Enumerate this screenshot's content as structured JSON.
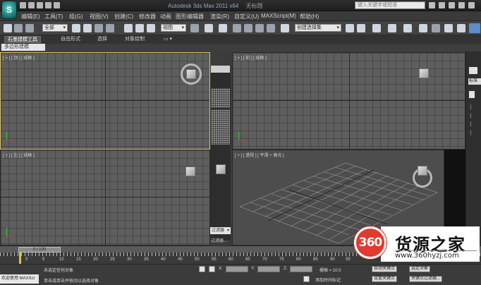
{
  "titlebar": {
    "logo_glyph": "S",
    "app_title": "Autodesk 3ds Max 2011 x64",
    "doc_title": "无标题",
    "search_placeholder": "键入关键字或短语"
  },
  "menu": [
    "编辑(E)",
    "工具(T)",
    "组(G)",
    "视图(V)",
    "创建(C)",
    "修改器",
    "动画",
    "图形编辑器",
    "渲染(R)",
    "自定义(U)",
    "MAXScript(M)",
    "帮助(H)"
  ],
  "toolbar": {
    "selection_filter": "全部",
    "ref_coord": "视图",
    "named_selection": "创建选择集"
  },
  "ribbon": {
    "tabs": [
      "石墨建模工具",
      "自由形式",
      "选择",
      "对象绘制"
    ],
    "active_tab": 0,
    "panel_label": "多边形建模"
  },
  "viewports": {
    "top": "[ + ] [ 顶 ] [ 线框 ]",
    "front": "[ + ] [ 前 ] [ 线框 ]",
    "left": "[ + ] [ 左 ] [ 线框 ]",
    "persp": "[ + ] [ 透视 ] [ 平滑 + 高光 ]"
  },
  "side": {
    "dropdown": "过滤器",
    "label": "过滤器..."
  },
  "cmdpanel": {
    "label": "标准"
  },
  "timeline": {
    "frame": "0 / 100",
    "ruler_numbers": [
      "0",
      "5",
      "10",
      "15",
      "20",
      "25",
      "30",
      "35",
      "40",
      "45",
      "50",
      "55",
      "60",
      "65",
      "70",
      "75",
      "80",
      "85",
      "90",
      "95",
      "100"
    ]
  },
  "status": {
    "welcome": "欢迎使用 MAXScr",
    "selection": "未选定任何对象",
    "prompt": "单击或单击并拖动以选择对象",
    "x_label": "X:",
    "y_label": "Y:",
    "z_label": "Z:",
    "grid": "栅格 = 10.0",
    "auto_key": "自动关键点",
    "set_key": "设置关键点",
    "selected": "选定对象",
    "key_filters": "关键点过滤器...",
    "add_tag": "添加时间标记"
  },
  "watermark": {
    "badge": "360",
    "title": "货源之家",
    "url": "www.360hyzj.com"
  },
  "colors": {
    "active_border": "#d9c56a",
    "badge_red": "#e23a2f"
  }
}
